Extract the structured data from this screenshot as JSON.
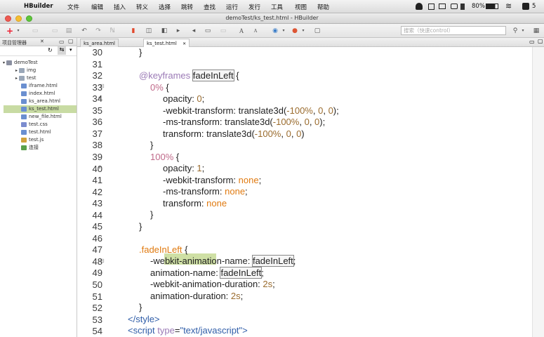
{
  "menubar": {
    "apple": "",
    "items": [
      "HBuilder",
      "文件",
      "编辑",
      "插入",
      "转义",
      "选择",
      "跳转",
      "查找",
      "运行",
      "发行",
      "工具",
      "视图",
      "帮助"
    ],
    "battery": "80%",
    "clock": "5"
  },
  "window": {
    "title": "demoTest/ks_test.html - HBuilder"
  },
  "search": {
    "placeholder": "搜索（快速control）"
  },
  "project_panel": {
    "title": "项目管理器",
    "tree": [
      {
        "label": "demoTest",
        "level": 0,
        "kind": "project"
      },
      {
        "label": "img",
        "level": 1,
        "kind": "folder"
      },
      {
        "label": "test",
        "level": 1,
        "kind": "folder"
      },
      {
        "label": "iframe.html",
        "level": 2,
        "kind": "html"
      },
      {
        "label": "index.html",
        "level": 2,
        "kind": "html"
      },
      {
        "label": "ks_area.html",
        "level": 2,
        "kind": "html"
      },
      {
        "label": "ks_test.html",
        "level": 2,
        "kind": "html",
        "selected": true
      },
      {
        "label": "new_file.html",
        "level": 2,
        "kind": "html"
      },
      {
        "label": "test.css",
        "level": 2,
        "kind": "css"
      },
      {
        "label": "test.html",
        "level": 2,
        "kind": "html"
      },
      {
        "label": "test.js",
        "level": 2,
        "kind": "js"
      },
      {
        "label": "连接",
        "level": 2,
        "kind": "link"
      }
    ]
  },
  "editor": {
    "tabs": [
      {
        "label": "ks_area.html",
        "active": false
      },
      {
        "label": "ks_test.html",
        "active": true
      }
    ],
    "line_numbers": [
      "30",
      "31",
      "32",
      "33",
      "34",
      "35",
      "36",
      "37",
      "38",
      "39",
      "40",
      "41",
      "42",
      "43",
      "44",
      "45",
      "46",
      "47",
      "48",
      "49",
      "50",
      "51",
      "52",
      "53",
      "54"
    ]
  }
}
